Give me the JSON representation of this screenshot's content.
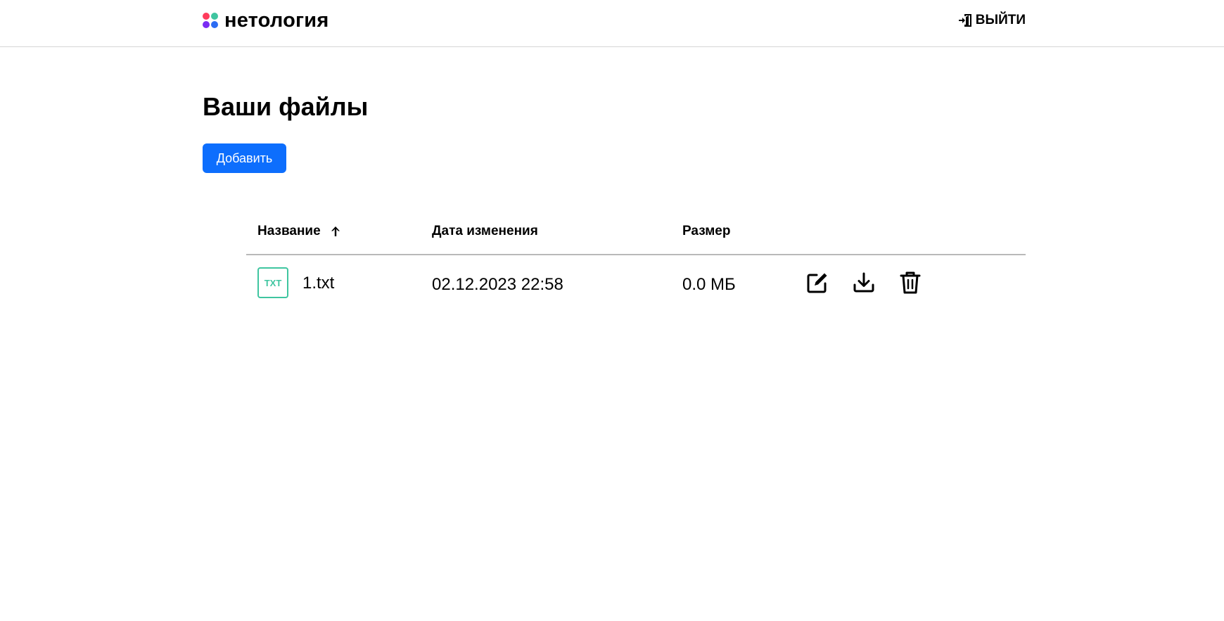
{
  "header": {
    "logo_text": "нетология",
    "logo_colors": [
      "#ff3b5c",
      "#3fc5a0",
      "#7a2cf3",
      "#2c6cf3"
    ],
    "logout_label": "ВЫЙТИ",
    "logout_icon": "logout-icon"
  },
  "main": {
    "title": "Ваши файлы",
    "add_button_label": "Добавить",
    "accent_color": "#0d6efd"
  },
  "table": {
    "columns": {
      "name": "Название",
      "date": "Дата изменения",
      "size": "Размер"
    },
    "sort": {
      "column": "name",
      "direction": "ascending",
      "icon": "arrow-up-icon"
    },
    "rows": [
      {
        "type_badge": "TXT",
        "name": "1.txt",
        "modified": "02.12.2023 22:58",
        "size": "0.0 МБ",
        "actions": [
          "edit-icon",
          "download-icon",
          "trash-icon"
        ]
      }
    ]
  }
}
